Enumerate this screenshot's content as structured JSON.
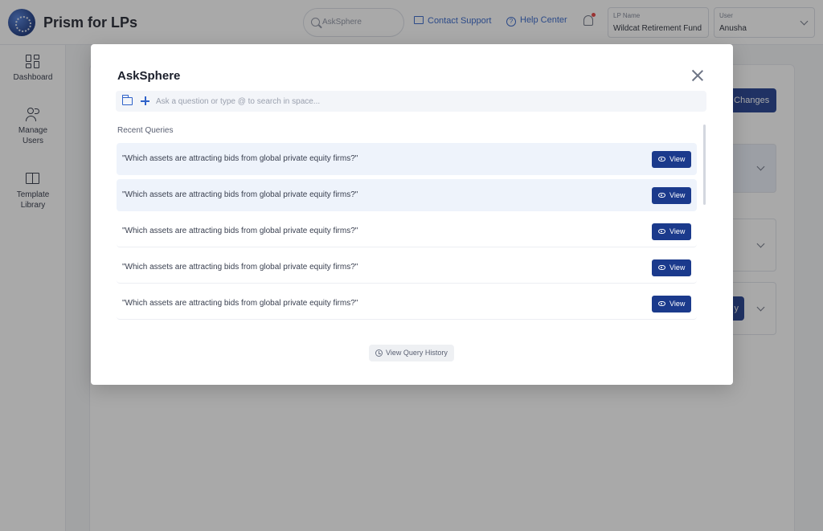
{
  "app": {
    "brand": "Prism for LPs",
    "search_placeholder": "AskSphere",
    "contact_support": "Contact Support",
    "help_center": "Help Center",
    "lp_name_label": "LP Name",
    "lp_name_value": "Wildcat Retirement Fund",
    "user_label": "User",
    "user_value": "Anusha"
  },
  "sidebar": {
    "items": [
      {
        "label": "Dashboard",
        "icon": "dashboard-icon"
      },
      {
        "label": "Manage Users",
        "icon": "users-icon"
      },
      {
        "label": "Template Library",
        "icon": "book-icon"
      }
    ]
  },
  "main": {
    "save_changes": "e Changes",
    "partial_button": "y"
  },
  "modal": {
    "title": "AskSphere",
    "ask_placeholder": "Ask a question or type @ to search in space...",
    "recent_label": "Recent Queries",
    "queries": [
      {
        "text": "\"Which assets are attracting bids from global private equity firms?\"",
        "action": "View"
      },
      {
        "text": "\"Which assets are attracting bids from global private equity firms?\"",
        "action": "View"
      },
      {
        "text": "\"Which assets are attracting bids from global private equity firms?\"",
        "action": "View"
      },
      {
        "text": "\"Which assets are attracting bids from global private equity firms?\"",
        "action": "View"
      },
      {
        "text": "\"Which assets are attracting bids from global private equity firms?\"",
        "action": "View"
      }
    ],
    "history_button": "View Query History"
  },
  "colors": {
    "primary": "#1b3a8c",
    "link": "#2f62c9",
    "highlight_row": "#eef3fb"
  }
}
